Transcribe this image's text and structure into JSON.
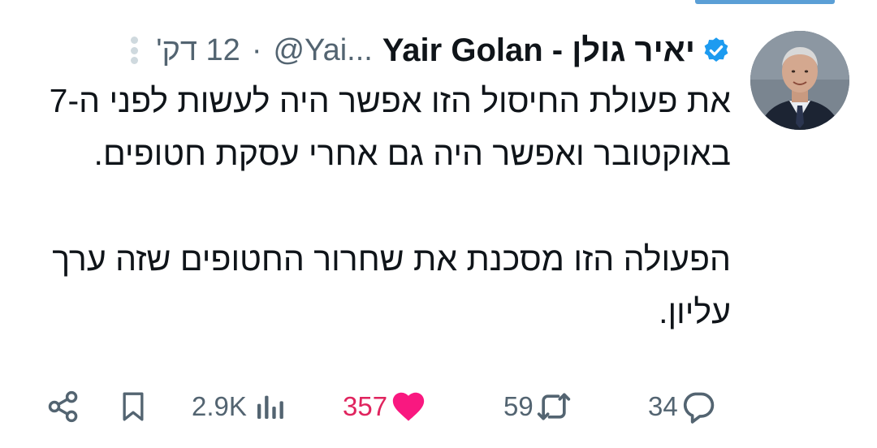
{
  "tweet": {
    "author": {
      "display_name": "יאיר גולן - Yair Golan",
      "handle": "@Yai...",
      "verified": true
    },
    "separator": "·",
    "time": "12 דק'",
    "text_paragraphs": [
      "את פעולת החיסול הזו אפשר היה לעשות לפני ה-7 באוקטובר ואפשר היה גם אחרי עסקת חטופים.",
      "הפעולה הזו מסכנת את שחרור החטופים שזה ערך עליון."
    ],
    "stats": {
      "replies": "34",
      "reposts": "59",
      "likes": "357",
      "views": "2.9K"
    }
  },
  "colors": {
    "accent": "#1d9bf0",
    "like": "#f91880",
    "secondary_text": "#536471",
    "top_bar": "#5b9fd6"
  },
  "icons": {
    "verified": "verified-badge-icon",
    "more": "more-vertical-icon",
    "reply": "reply-icon",
    "repost": "repost-icon",
    "like": "heart-filled-icon",
    "views": "views-bar-chart-icon",
    "bookmark": "bookmark-icon",
    "share": "share-icon"
  }
}
